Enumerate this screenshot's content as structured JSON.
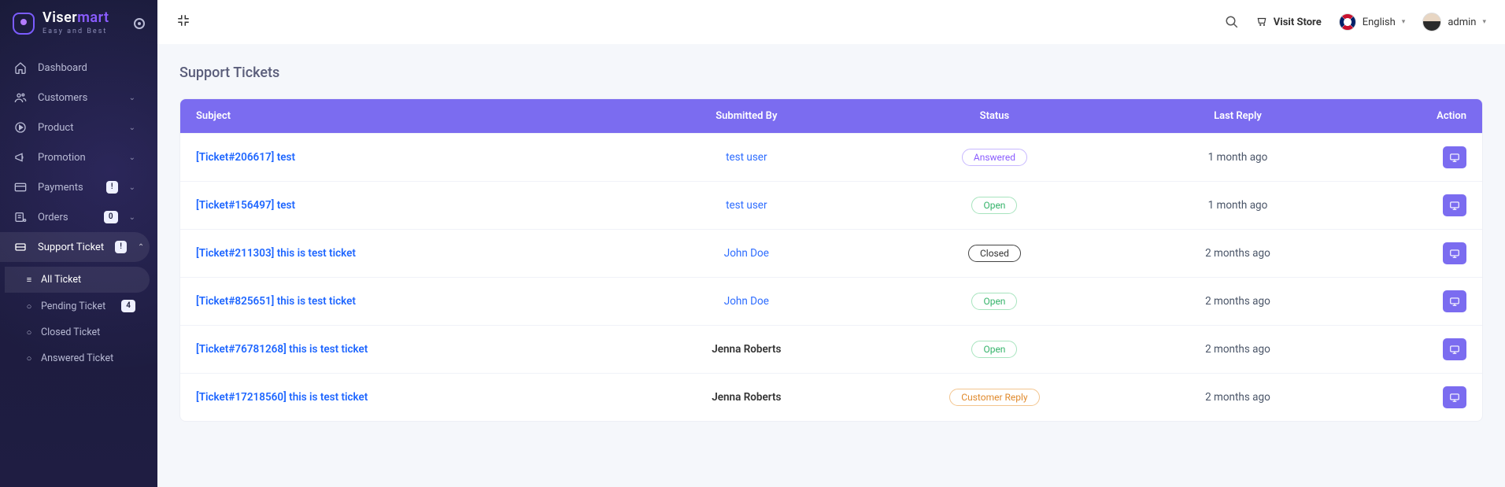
{
  "brand": {
    "name_left": "Viser",
    "name_right": "mart",
    "tagline": "Easy and Best"
  },
  "sidebar": {
    "items": [
      {
        "icon": "home",
        "label": "Dashboard"
      },
      {
        "icon": "users",
        "label": "Customers",
        "expandable": true
      },
      {
        "icon": "play",
        "label": "Product",
        "expandable": true
      },
      {
        "icon": "megaphone",
        "label": "Promotion",
        "expandable": true
      },
      {
        "icon": "card",
        "label": "Payments",
        "expandable": true,
        "badge": "!"
      },
      {
        "icon": "orders",
        "label": "Orders",
        "expandable": true,
        "badge": "0"
      },
      {
        "icon": "ticket",
        "label": "Support Ticket",
        "expandable": true,
        "expanded": true,
        "active": true,
        "badge": "!"
      }
    ],
    "submenu": [
      {
        "label": "All Ticket",
        "active": true
      },
      {
        "label": "Pending Ticket",
        "badge": "4"
      },
      {
        "label": "Closed Ticket"
      },
      {
        "label": "Answered Ticket"
      }
    ]
  },
  "topbar": {
    "visit_label": "Visit Store",
    "language": "English",
    "admin": "admin"
  },
  "page": {
    "title": "Support Tickets"
  },
  "table": {
    "headers": {
      "subject": "Subject",
      "submitted_by": "Submitted By",
      "status": "Status",
      "last_reply": "Last Reply",
      "action": "Action"
    },
    "rows": [
      {
        "subject": "[Ticket#206617] test",
        "submitted_by": "test user",
        "submitted_link": true,
        "status": "Answered",
        "status_class": "answered",
        "last_reply": "1 month ago"
      },
      {
        "subject": "[Ticket#156497] test",
        "submitted_by": "test user",
        "submitted_link": true,
        "status": "Open",
        "status_class": "open",
        "last_reply": "1 month ago"
      },
      {
        "subject": "[Ticket#211303] this is test ticket",
        "submitted_by": "John Doe",
        "submitted_link": true,
        "status": "Closed",
        "status_class": "closed",
        "last_reply": "2 months ago"
      },
      {
        "subject": "[Ticket#825651] this is test ticket",
        "submitted_by": "John Doe",
        "submitted_link": true,
        "status": "Open",
        "status_class": "open",
        "last_reply": "2 months ago"
      },
      {
        "subject": "[Ticket#76781268] this is test ticket",
        "submitted_by": "Jenna Roberts",
        "submitted_link": false,
        "status": "Open",
        "status_class": "open",
        "last_reply": "2 months ago"
      },
      {
        "subject": "[Ticket#17218560] this is test ticket",
        "submitted_by": "Jenna Roberts",
        "submitted_link": false,
        "status": "Customer Reply",
        "status_class": "customer",
        "last_reply": "2 months ago"
      }
    ]
  },
  "colors": {
    "accent": "#7b6cf0",
    "sidebar_bg": "#1a1b3a",
    "link": "#1e66ff"
  }
}
